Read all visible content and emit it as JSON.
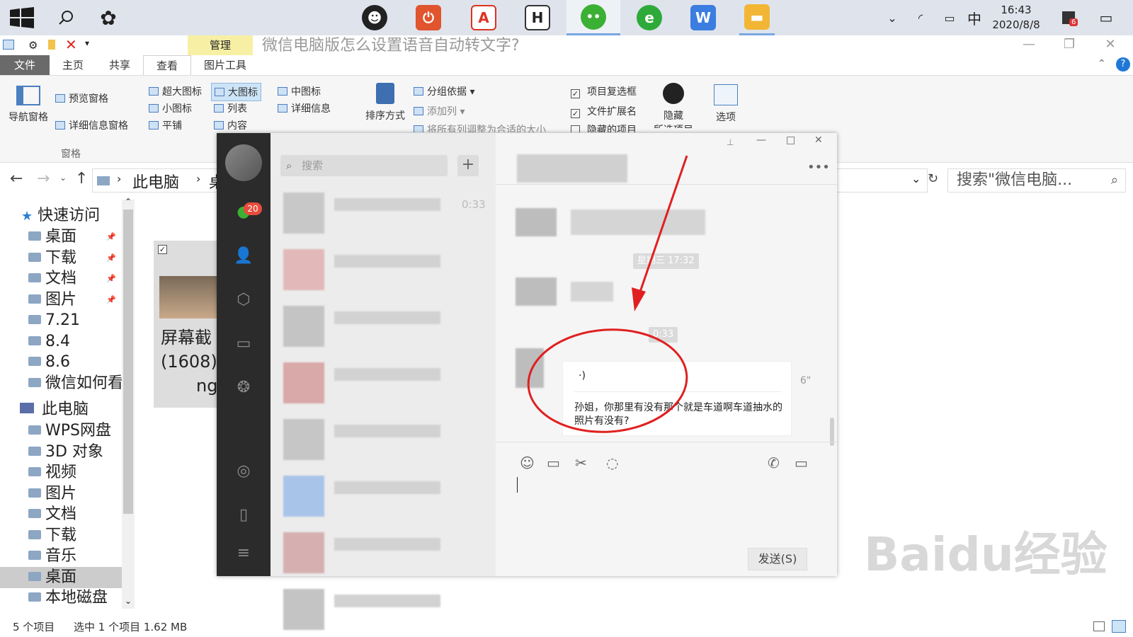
{
  "taskbar": {
    "clock_time": "16:43",
    "clock_date": "2020/8/8",
    "ime": "中",
    "notify_badge": "6"
  },
  "explorer": {
    "title": "微信电脑版怎么设置语音自动转文字?",
    "context_tab": "管理",
    "tabs": [
      "文件",
      "主页",
      "共享",
      "查看",
      "图片工具"
    ],
    "ribbon": {
      "nav_pane": "导航窗格",
      "preview_pane": "预览窗格",
      "details_pane": "详细信息窗格",
      "pane_group": "窗格",
      "extra_large": "超大图标",
      "large": "大图标",
      "medium": "中图标",
      "small": "小图标",
      "list": "列表",
      "details": "详细信息",
      "tiles": "平铺",
      "content": "内容",
      "sort_by": "排序方式",
      "group_by": "分组依据",
      "add_column": "添加列",
      "fit_columns": "将所有列调整为合适的大小",
      "item_checkbox": "项目复选框",
      "file_ext": "文件扩展名",
      "hidden_items": "隐藏的项目",
      "hide": "隐藏",
      "hide_selected": "所选项目",
      "options": "选项"
    },
    "address": {
      "pc": "此电脑",
      "next": "桌"
    },
    "search_placeholder": "搜索\"微信电脑...",
    "nav": {
      "quick_access": "快速访问",
      "quick_items": [
        "桌面",
        "下载",
        "文档",
        "图片",
        "7.21",
        "8.4",
        "8.6",
        "微信如何看"
      ],
      "this_pc": "此电脑",
      "pc_items": [
        "WPS网盘",
        "3D 对象",
        "视频",
        "图片",
        "文档",
        "下载",
        "音乐",
        "桌面",
        "本地磁盘"
      ]
    },
    "file_tile": {
      "line1": "屏幕截",
      "line2": "(1608)",
      "line3": "ng"
    },
    "status": {
      "count": "5 个项目",
      "selected": "选中 1 个项目  1.62 MB"
    }
  },
  "wechat": {
    "badge": "20",
    "search_placeholder": "搜索",
    "list_time": "0:33",
    "stamp1": "星期三 17:32",
    "stamp2": "0:33",
    "voice_duration": "6\"",
    "transcript": "孙姐，你那里有没有那个就是车道啊车道抽水的照片有没有?",
    "send": "发送(S)"
  },
  "watermark": "Baidu经验"
}
